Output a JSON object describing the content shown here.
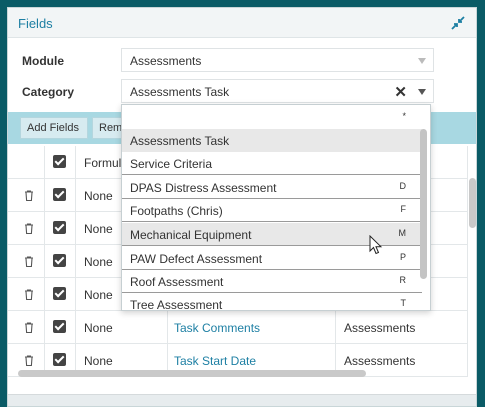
{
  "window": {
    "title": "Fields"
  },
  "form": {
    "module_label": "Module",
    "module_value": "Assessments",
    "category_label": "Category",
    "category_value": "Assessments Task"
  },
  "toolbar": {
    "add_fields_label": "Add Fields",
    "remove_label": "Rem"
  },
  "grid": {
    "header": {
      "formula": "Formul"
    },
    "rows": [
      {
        "formula": "None",
        "field": "",
        "module": ""
      },
      {
        "formula": "None",
        "field": "",
        "module": ""
      },
      {
        "formula": "None",
        "field": "",
        "module": ""
      },
      {
        "formula": "None",
        "field": "",
        "module": ""
      },
      {
        "formula": "None",
        "field": "Task Comments",
        "module": "Assessments"
      },
      {
        "formula": "None",
        "field": "Task Start Date",
        "module": "Assessments"
      }
    ]
  },
  "dropdown": {
    "items": [
      {
        "label": "",
        "code": "*"
      },
      {
        "label": "Assessments Task",
        "code": ""
      },
      {
        "label": "Service Criteria",
        "code": ""
      },
      {
        "label": "DPAS Distress Assessment",
        "code": "D"
      },
      {
        "label": "Footpaths (Chris)",
        "code": "F"
      },
      {
        "label": "Mechanical Equipment",
        "code": "M"
      },
      {
        "label": "PAW Defect Assessment",
        "code": "P"
      },
      {
        "label": "Roof Assessment",
        "code": "R"
      },
      {
        "label": "Tree Assessment",
        "code": "T"
      }
    ]
  },
  "colors": {
    "accent": "#1d7fa3",
    "frame": "#0a5b66",
    "toolbar": "#a8d8e2"
  },
  "icons": [
    "collapse-icon",
    "trash-icon",
    "chevron-down-icon",
    "clear-icon",
    "mouse-cursor-icon"
  ]
}
